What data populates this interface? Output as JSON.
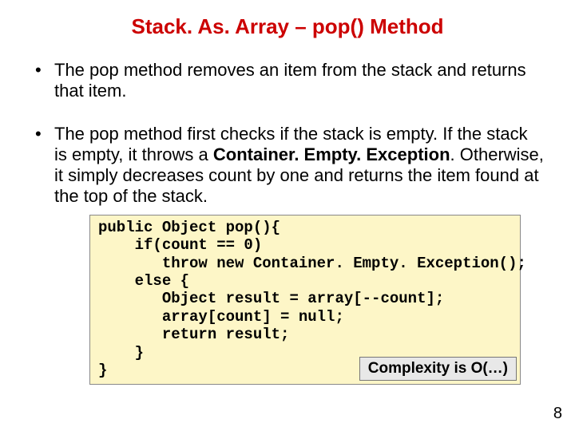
{
  "title": "Stack. As. Array – pop() Method",
  "bullets": [
    {
      "text": "The pop method removes an item from the stack and returns that item."
    },
    {
      "pre": "The pop method first checks if the stack is empty. If the stack is empty, it throws a ",
      "bold": "Container. Empty. Exception",
      "post": ". Otherwise, it simply decreases count by one and returns the item found at the top of the stack."
    }
  ],
  "code": {
    "l1": "public Object pop(){",
    "l2": "    if(count == 0)",
    "l3": "       throw new Container. Empty. Exception();",
    "l4": "    else {",
    "l5": "       Object result = array[--count];",
    "l6": "       array[count] = null;",
    "l7": "       return result;",
    "l8": "    }",
    "l9": "}"
  },
  "complexity": "Complexity is O(…)",
  "page_number": "8"
}
